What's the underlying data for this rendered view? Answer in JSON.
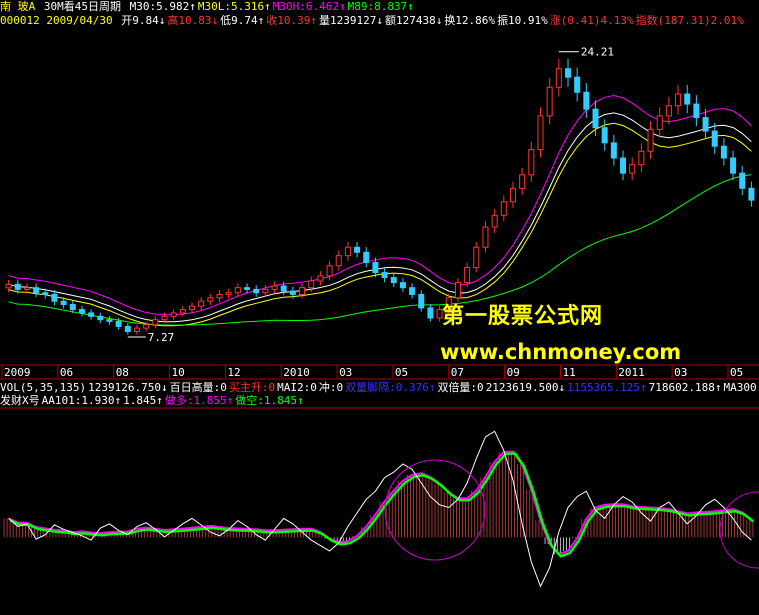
{
  "header": {
    "name": "南  玻A",
    "period": "30M看45日周期",
    "ma": [
      {
        "label": "M30:5.982",
        "arrow": "↑",
        "color": "#ffffff"
      },
      {
        "label": "M30L:5.316",
        "arrow": "↑",
        "color": "#ffff00"
      },
      {
        "label": "M30H:6.462",
        "arrow": "↑",
        "color": "#ff00ff"
      },
      {
        "label": "M89:8.837",
        "arrow": "↑",
        "color": "#00ff00"
      }
    ]
  },
  "quote_line": {
    "code_date": "000012 2009/04/30",
    "items": [
      {
        "text": "开9.84",
        "arrow": "↓",
        "color": "#ffffff"
      },
      {
        "text": "高10.83",
        "arrow": "↓",
        "color": "#ff3333"
      },
      {
        "text": "低9.74",
        "arrow": "↑",
        "color": "#ffffff"
      },
      {
        "text": "收10.39",
        "arrow": "↑",
        "color": "#ff3333"
      },
      {
        "text": "量1239127",
        "arrow": "↓",
        "color": "#ffffff"
      },
      {
        "text": "额127438",
        "arrow": "↓",
        "color": "#ffffff"
      },
      {
        "text": "换12.86%",
        "arrow": "",
        "color": "#ffffff"
      },
      {
        "text": "振10.91%",
        "arrow": "",
        "color": "#ffffff"
      },
      {
        "text": "涨(0.41)4.13%",
        "arrow": "",
        "color": "#ff3333"
      },
      {
        "text": "指数(187.31)2.01%",
        "arrow": "",
        "color": "#ff3333"
      }
    ]
  },
  "annotations": {
    "high_label": "24.21",
    "low_label": "7.27"
  },
  "x_axis_labels": [
    "2009",
    "06",
    "08",
    "10",
    "12",
    "2010",
    "03",
    "05",
    "07",
    "09",
    "11",
    "2011",
    "03",
    "05"
  ],
  "vol_line": {
    "items": [
      {
        "text": "VOL(5,35,135)",
        "color": "#ffffff"
      },
      {
        "text": "1239126.750↓",
        "color": "#ffffff"
      },
      {
        "text": "百日高量:0",
        "color": "#ffffff"
      },
      {
        "text": "买主升:0",
        "color": "#ff3333"
      },
      {
        "text": "MAI2:0",
        "color": "#ffffff"
      },
      {
        "text": "冲:0",
        "color": "#ffffff"
      },
      {
        "text": "双量脚隔:0.376↑",
        "color": "#3333ff"
      },
      {
        "text": "双倍量:0",
        "color": "#ffffff"
      },
      {
        "text": "2123619.500↓",
        "color": "#ffffff"
      },
      {
        "text": "1155365.125↑",
        "color": "#3333ff"
      },
      {
        "text": "718602.188↑",
        "color": "#ffffff"
      },
      {
        "text": "MA300",
        "color": "#ffffff"
      }
    ]
  },
  "indicator_line": {
    "items": [
      {
        "text": "发财X号",
        "color": "#ffffff"
      },
      {
        "text": "AA101:1.930↑",
        "color": "#ffffff"
      },
      {
        "text": "1.845↑",
        "color": "#ffffff"
      },
      {
        "text": "做多:1.855↑",
        "color": "#ff00ff"
      },
      {
        "text": "做空:1.845↑",
        "color": "#00ff00"
      }
    ]
  },
  "watermark": {
    "line1": "第一股票公式网",
    "line2": "www.chnmoney.com"
  },
  "colors": {
    "up": "#ff3333",
    "down": "#33ccff",
    "m30": "#ffffff",
    "m30l": "#ffff00",
    "m30h": "#ff00ff",
    "m89": "#00ff00",
    "axis": "#b00000"
  },
  "chart_data": [
    {
      "type": "candlestick",
      "title": "南玻A 30M看45日周期",
      "x_labels": [
        "2009",
        "06",
        "08",
        "10",
        "12",
        "2010",
        "03",
        "05",
        "07",
        "09",
        "11",
        "2011",
        "03",
        "05"
      ],
      "ylim": [
        6.5,
        25.5
      ],
      "close": [
        10.4,
        10.1,
        10.2,
        9.9,
        9.8,
        9.4,
        9.2,
        8.9,
        8.7,
        8.5,
        8.3,
        8.2,
        7.9,
        7.6,
        7.8,
        8.0,
        8.3,
        8.5,
        8.7,
        8.9,
        9.1,
        9.4,
        9.6,
        9.8,
        9.9,
        10.2,
        10.1,
        9.9,
        10.1,
        10.3,
        10.0,
        9.8,
        10.2,
        10.6,
        10.9,
        11.5,
        12.1,
        12.6,
        12.3,
        11.7,
        11.1,
        10.8,
        10.5,
        10.2,
        9.8,
        9.0,
        8.4,
        8.9,
        9.6,
        10.5,
        11.4,
        12.6,
        13.8,
        14.5,
        15.3,
        16.1,
        16.9,
        18.4,
        20.4,
        22.1,
        23.2,
        22.7,
        21.8,
        20.8,
        19.7,
        18.8,
        17.9,
        17.0,
        17.5,
        18.3,
        19.6,
        20.4,
        21.0,
        21.7,
        21.1,
        20.3,
        19.5,
        18.6,
        17.9,
        17.0,
        16.1,
        15.4
      ],
      "series": [
        {
          "name": "M30",
          "last": 5.982
        },
        {
          "name": "M30L",
          "last": 5.316
        },
        {
          "name": "M30H",
          "last": 6.462
        },
        {
          "name": "M89",
          "last": 8.837
        }
      ],
      "high_point": 24.21,
      "low_point": 7.27
    },
    {
      "type": "line",
      "title": "发财X号",
      "series": [
        {
          "name": "AA101",
          "last": 1.93,
          "values": [
            0.7,
            0.55,
            0.6,
            0.32,
            0.4,
            0.58,
            0.5,
            0.44,
            0.38,
            0.3,
            0.52,
            0.6,
            0.48,
            0.4,
            0.55,
            0.62,
            0.5,
            0.36,
            0.48,
            0.6,
            0.7,
            0.58,
            0.45,
            0.38,
            0.5,
            0.66,
            0.55,
            0.4,
            0.3,
            0.5,
            0.7,
            0.6,
            0.45,
            0.3,
            0.2,
            0.1,
            0.25,
            0.55,
            0.8,
            1.05,
            1.2,
            1.45,
            1.55,
            1.7,
            1.6,
            1.35,
            1.1,
            0.95,
            0.9,
            1.05,
            1.35,
            1.8,
            2.2,
            2.3,
            1.95,
            1.4,
            0.6,
            -0.1,
            -0.55,
            -0.2,
            0.45,
            0.9,
            1.1,
            1.2,
            0.85,
            0.7,
            0.95,
            1.1,
            1.0,
            0.8,
            0.65,
            0.9,
            1.0,
            0.8,
            0.6,
            0.75,
            0.95,
            1.05,
            0.9,
            0.7,
            0.45,
            0.3
          ]
        },
        {
          "name": "做多",
          "last": 1.855
        },
        {
          "name": "做空",
          "last": 1.845
        }
      ]
    }
  ]
}
